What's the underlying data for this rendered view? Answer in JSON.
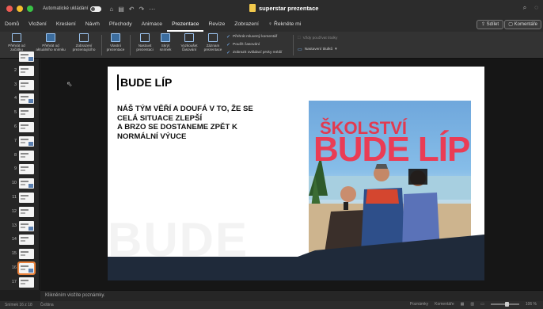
{
  "titlebar": {
    "autosave_label": "Automatické ukládání",
    "doc_title": "superstar prezentace",
    "icons": [
      "home-icon",
      "save-icon",
      "undo-icon",
      "redo-icon",
      "more-icon"
    ]
  },
  "tabs": [
    {
      "label": "Domů",
      "active": false
    },
    {
      "label": "Vložení",
      "active": false
    },
    {
      "label": "Kreslení",
      "active": false
    },
    {
      "label": "Návrh",
      "active": false
    },
    {
      "label": "Přechody",
      "active": false
    },
    {
      "label": "Animace",
      "active": false
    },
    {
      "label": "Prezentace",
      "active": true
    },
    {
      "label": "Revize",
      "active": false
    },
    {
      "label": "Zobrazení",
      "active": false
    },
    {
      "label": "Řekněte mi",
      "active": false
    }
  ],
  "share_label": "Sdílet",
  "comments_label": "Komentáře",
  "ribbon": {
    "buttons": [
      {
        "label1": "Přehrát od",
        "label2": "začátku"
      },
      {
        "label1": "Přehrát od",
        "label2": "aktuálního snímku"
      },
      {
        "label1": "Zobrazení",
        "label2": "prezentujícího"
      },
      {
        "label1": "Vlastní",
        "label2": "prezentace"
      },
      {
        "label1": "Nastavit",
        "label2": "prezentaci"
      },
      {
        "label1": "Skrýt",
        "label2": "snímek"
      },
      {
        "label1": "Vyzkoušet",
        "label2": "časování"
      },
      {
        "label1": "Záznam",
        "label2": "prezentace"
      }
    ],
    "checks": [
      {
        "label": "Přehrát mluvený komentář",
        "checked": true
      },
      {
        "label": "Použít časování",
        "checked": true
      },
      {
        "label": "Zobrazit ovládací prvky médií",
        "checked": true
      }
    ],
    "always_subtitles": "Vždy používat titulky",
    "subtitle_settings": "Nastavení titulků"
  },
  "thumbnails": [
    {
      "num": ""
    },
    {
      "num": "2"
    },
    {
      "num": "3"
    },
    {
      "num": "4"
    },
    {
      "num": "5"
    },
    {
      "num": "6"
    },
    {
      "num": "7"
    },
    {
      "num": "8"
    },
    {
      "num": "9"
    },
    {
      "num": "10"
    },
    {
      "num": "11"
    },
    {
      "num": "12"
    },
    {
      "num": "13"
    },
    {
      "num": "14"
    },
    {
      "num": "15"
    },
    {
      "num": "16"
    },
    {
      "num": "17"
    }
  ],
  "selected_slide": "16",
  "slide": {
    "title": "BUDE LÍP",
    "body": [
      "NÁŠ TÝM VĚŘÍ A DOUFÁ V TO, ŽE SE",
      "CELÁ SITUACE ZLEPŠÍ",
      "A BRZO SE DOSTANEME ZPĚT K",
      "NORMÁLNÍ VÝUCE"
    ],
    "watermark": "BUDE",
    "photo_text_top": "ŠKOLSTVÍ",
    "photo_text_big": "BUDE LÍP"
  },
  "notes_placeholder": "Klikněním vložíte poznámky.",
  "status": {
    "slide_counter": "Snímek 16 z 18",
    "language": "Čeština",
    "notes": "Poznámky",
    "comments": "Komentáře",
    "zoom": "106 %"
  },
  "colors": {
    "accent": "#e8803a",
    "slide_dark": "#1f2a3a",
    "photo_text": "#ea3c55"
  }
}
